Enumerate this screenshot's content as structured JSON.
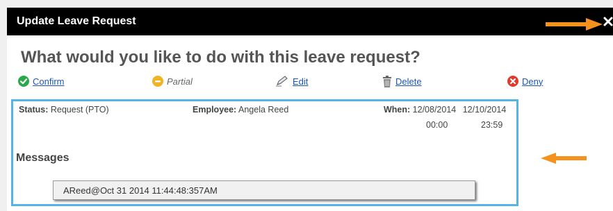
{
  "dialog": {
    "title": "Update Leave Request",
    "question": "What would you like to do with this leave request?"
  },
  "actions": {
    "confirm": "Confirm",
    "partial": "Partial",
    "edit": "Edit",
    "delete": "Delete",
    "deny": "Deny"
  },
  "details": {
    "status_label": "Status:",
    "status_value": "Request (PTO)",
    "employee_label": "Employee:",
    "employee_value": "Angela Reed",
    "when_label": "When:",
    "start_date": "12/08/2014",
    "end_date": "12/10/2014",
    "start_time": "00:00",
    "end_time": "23:59"
  },
  "messages": {
    "header": "Messages",
    "items": [
      "AReed@Oct 31 2014 11:44:48:357AM"
    ]
  },
  "colors": {
    "titlebar": "#000000",
    "highlight_border": "#55b4e6",
    "arrow": "#f5921e",
    "confirm": "#2aa84a",
    "partial": "#f2b322",
    "deny": "#e03b2c",
    "link": "#1b55b8"
  },
  "icons": {
    "close": "close-icon",
    "confirm": "check-circle-icon",
    "partial": "minus-circle-icon",
    "edit": "pencil-icon",
    "delete": "trash-icon",
    "deny": "x-circle-icon"
  }
}
